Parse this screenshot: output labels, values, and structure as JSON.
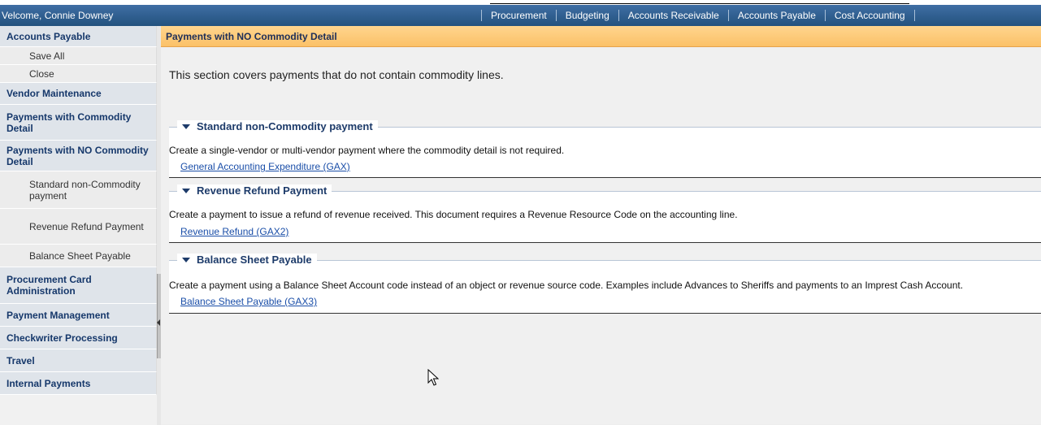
{
  "header": {
    "welcome": "Velcome, Connie Downey",
    "nav": [
      "Procurement",
      "Budgeting",
      "Accounts Receivable",
      "Accounts Payable",
      "Cost Accounting"
    ]
  },
  "sidebar": {
    "items": [
      {
        "label": "Accounts Payable",
        "kind": "cat"
      },
      {
        "label": "Save All",
        "kind": "sub"
      },
      {
        "label": "Close",
        "kind": "sub"
      },
      {
        "label": "Vendor Maintenance",
        "kind": "cat"
      },
      {
        "label": "Payments with Commodity Detail",
        "kind": "cat"
      },
      {
        "label": "Payments with NO Commodity Detail",
        "kind": "cat"
      },
      {
        "label": "Standard non-Commodity payment",
        "kind": "sub"
      },
      {
        "label": "Revenue Refund Payment",
        "kind": "sub"
      },
      {
        "label": "Balance Sheet Payable",
        "kind": "sub"
      },
      {
        "label": "Procurement Card Administration",
        "kind": "cat"
      },
      {
        "label": "Payment Management",
        "kind": "cat"
      },
      {
        "label": "Checkwriter Processing",
        "kind": "cat"
      },
      {
        "label": "Travel",
        "kind": "cat"
      },
      {
        "label": "Internal Payments",
        "kind": "cat"
      }
    ]
  },
  "main": {
    "title": "Payments with NO Commodity Detail",
    "intro": "This section covers payments that do not contain commodity lines.",
    "sections": [
      {
        "title": "Standard non-Commodity payment",
        "description": "Create a single-vendor or multi-vendor payment where the commodity detail is not required.",
        "link": "General Accounting Expenditure (GAX)"
      },
      {
        "title": "Revenue Refund Payment",
        "description": "Create a payment to issue a refund of revenue received. This document requires a Revenue Resource Code on the accounting line.",
        "link": "Revenue Refund (GAX2)"
      },
      {
        "title": "Balance Sheet Payable",
        "description": "Create a payment using a Balance Sheet Account code instead of an object or revenue source code. Examples include Advances to Sheriffs and payments to an Imprest Cash Account.",
        "link": "Balance Sheet Payable (GAX3)"
      }
    ]
  },
  "icons": {
    "expand": "triangle-down-icon",
    "collapse": "collapse-left-icon",
    "cursor": "mouse-pointer-icon"
  },
  "colors": {
    "header": "#2f5f93",
    "title_bar": "#fbc570",
    "category_text": "#16386b",
    "link": "#1a4ea8"
  }
}
